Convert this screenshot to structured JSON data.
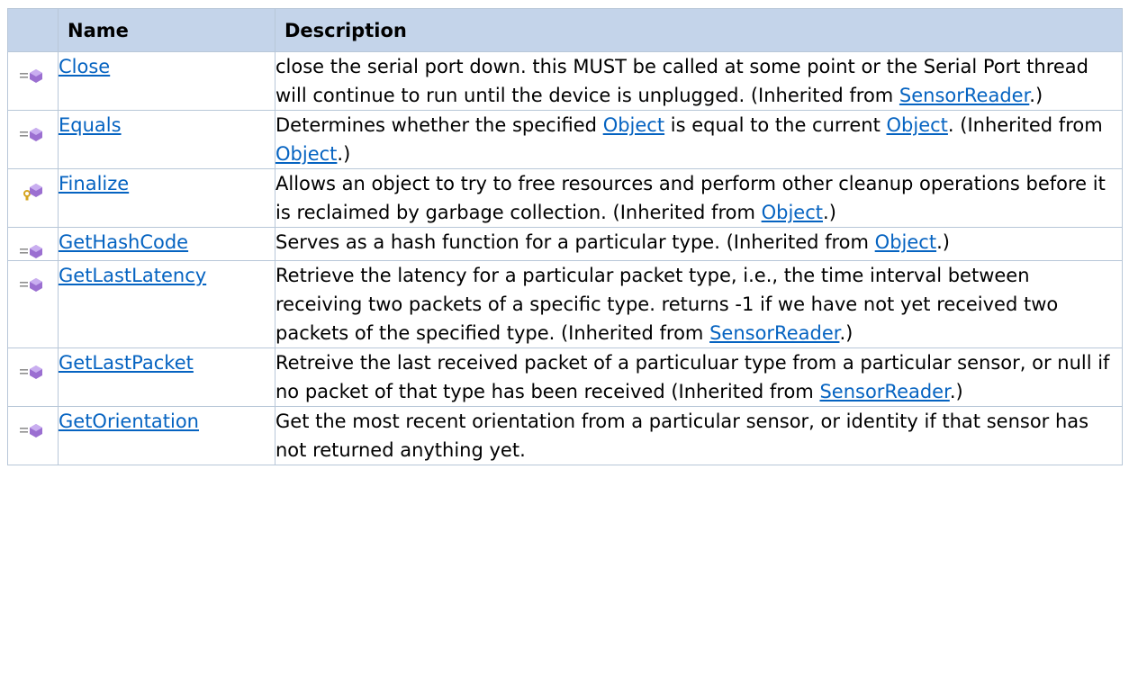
{
  "header": {
    "name": "Name",
    "description": "Description"
  },
  "rows": [
    {
      "icon": "public-method-icon",
      "name": "Close",
      "desc": [
        {
          "t": "close the serial port down. this MUST be called at some point or the Serial Port thread will continue to run until the device is unplugged. (Inherited from "
        },
        {
          "link": "SensorReader"
        },
        {
          "t": ".)"
        }
      ]
    },
    {
      "icon": "public-method-icon",
      "name": "Equals",
      "desc": [
        {
          "t": "Determines whether the specified "
        },
        {
          "link": "Object"
        },
        {
          "t": " is equal to the current "
        },
        {
          "link": "Object"
        },
        {
          "t": ". (Inherited from "
        },
        {
          "link": "Object"
        },
        {
          "t": ".)"
        }
      ]
    },
    {
      "icon": "protected-method-icon",
      "name": "Finalize",
      "desc": [
        {
          "t": "Allows an object to try to free resources and perform other cleanup operations before it is reclaimed by garbage collection. (Inherited from "
        },
        {
          "link": "Object"
        },
        {
          "t": ".)"
        }
      ]
    },
    {
      "icon": "public-method-icon",
      "name": "GetHashCode",
      "desc": [
        {
          "t": "Serves as a hash function for a particular type. (Inherited from "
        },
        {
          "link": "Object"
        },
        {
          "t": ".)"
        }
      ]
    },
    {
      "icon": "public-method-icon",
      "name": "GetLastLatency",
      "desc": [
        {
          "t": "Retrieve the latency for a particular packet type, i.e., the time interval between receiving two packets of a specific type. returns -1 if we have not yet received two packets of the specified type. (Inherited from "
        },
        {
          "link": "SensorReader"
        },
        {
          "t": ".)"
        }
      ]
    },
    {
      "icon": "public-method-icon",
      "name": "GetLastPacket",
      "desc": [
        {
          "t": "Retreive the last received packet of a particuluar type from a particular sensor, or null if no packet of that type has been received (Inherited from "
        },
        {
          "link": "SensorReader"
        },
        {
          "t": ".)"
        }
      ]
    },
    {
      "icon": "public-method-icon",
      "name": "GetOrientation",
      "desc": [
        {
          "t": "Get the most recent orientation from a particular sensor, or identity if that sensor has not returned anything yet."
        }
      ]
    }
  ],
  "colors": {
    "header_bg": "#c4d4ea",
    "border": "#b8c7d8",
    "link": "#0563c1",
    "icon_purple": "#9b6fd1",
    "icon_key": "#d6a520"
  }
}
